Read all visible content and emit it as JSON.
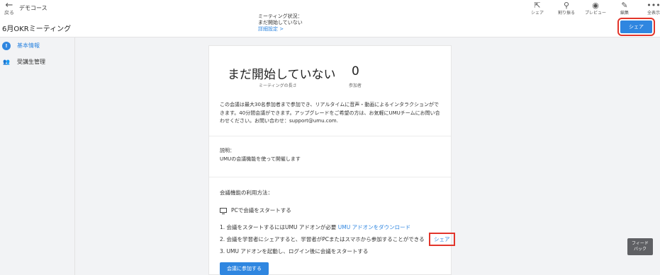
{
  "header": {
    "back_label": "戻る",
    "course_name": "デモコース",
    "meeting_title": "6月OKRミーティング",
    "tools": [
      {
        "icon": "export-icon",
        "label": "シェア"
      },
      {
        "icon": "assign-icon",
        "label": "割り振る"
      },
      {
        "icon": "eye-icon",
        "label": "プレビュー"
      },
      {
        "icon": "edit-icon",
        "label": "編集"
      },
      {
        "icon": "more-icon",
        "label": "全表示"
      }
    ],
    "share_button": "シェア"
  },
  "sidebar": {
    "items": [
      {
        "label": "基本情報",
        "active": true
      },
      {
        "label": "受講生管理",
        "active": false
      }
    ]
  },
  "main": {
    "status_big": "まだ開始していない",
    "length_label": "ミーティングの長さ",
    "participant_count": "0",
    "participant_label": "参加者",
    "state_label": "ミーティング状況：",
    "state_value": "まだ開始していない",
    "details_link": "詳細設定 >",
    "notice": "この会議は最大30名参加者まで参加でき、リアルタイムに音声・動画によるインタラクションができます。40分間会議ができます。アップグレードをご希望の方は、お気軽にUMUチームにお問い合わせください。お問い合わせ：support@umu.com.",
    "description_label": "説明：",
    "description_text": "UMUの会議機能を使って開催します",
    "usage_heading": "会議機能の利用方法：",
    "pc_heading": "PCで会議をスタートする",
    "step1_text": "1. 会議をスタートするにはUMU アドオンが必要",
    "step1_link": "UMU アドオンをダウンロード",
    "step2_text": "2. 会議を学習者にシェアすると、学習者がPCまたはスマホから参加することができる",
    "step2_link": "シェア",
    "step3_text": "3. UMU アドオンを起動し、ログイン後に会議をスタートする",
    "join_button": "会議に参加する"
  },
  "feedback": {
    "line1": "フィード",
    "line2": "バック"
  },
  "colors": {
    "accent": "#2f86e0",
    "highlight": "#e2352b"
  }
}
